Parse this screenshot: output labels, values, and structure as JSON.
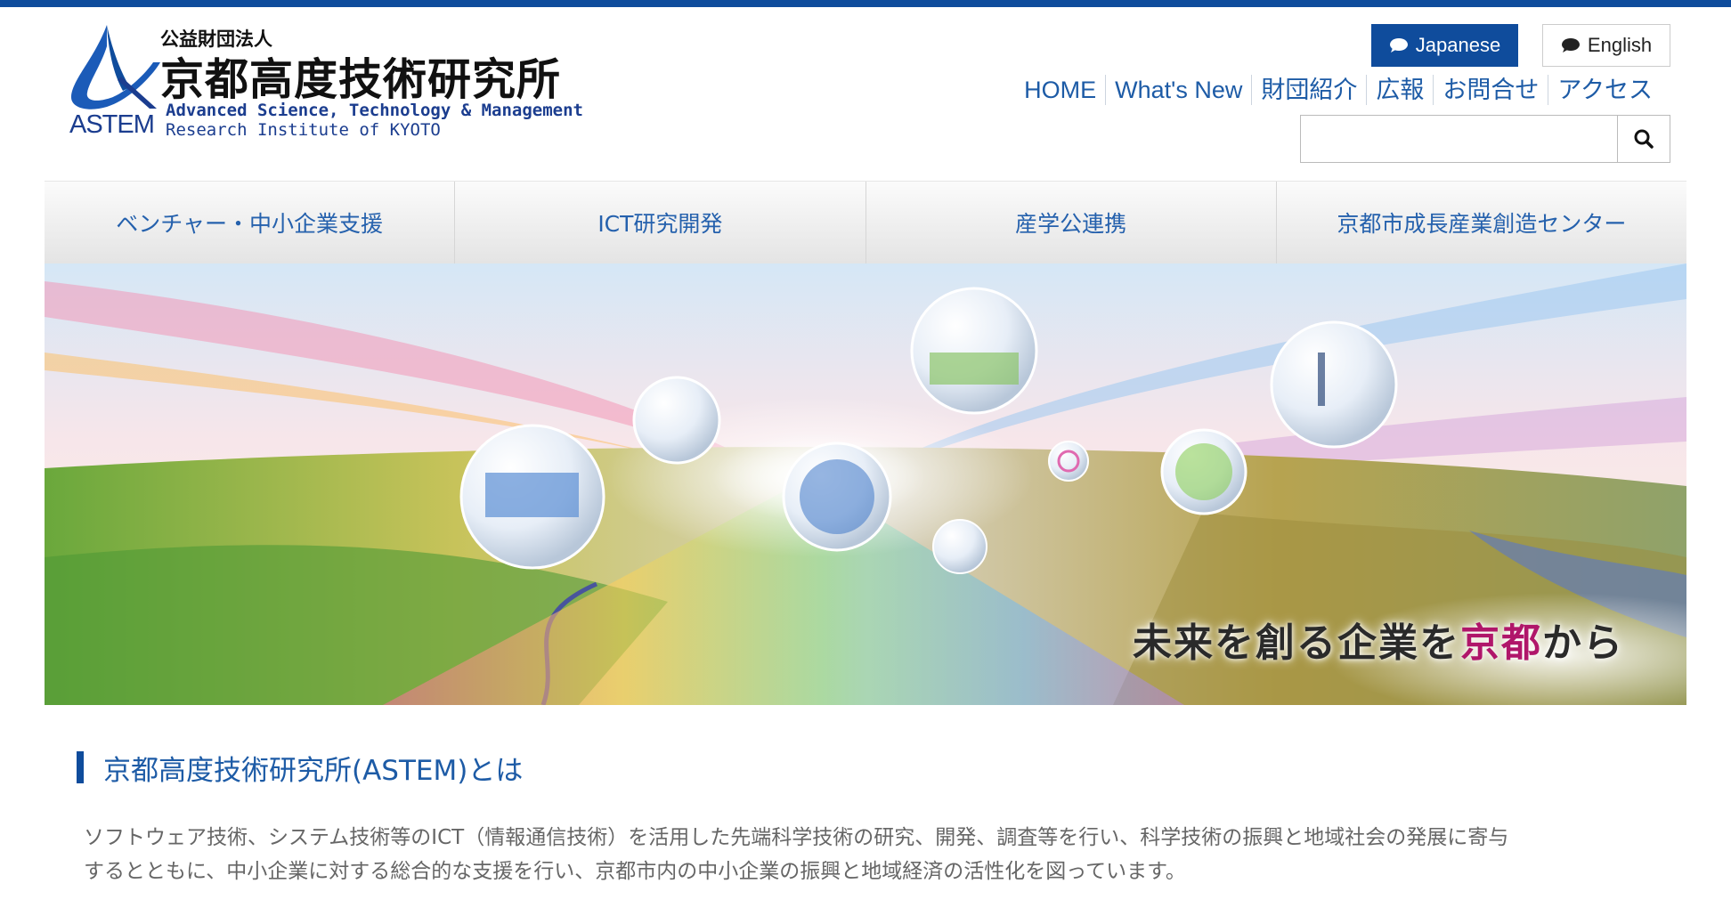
{
  "logo": {
    "small_text": "公益財団法人",
    "title": "京都高度技術研究所",
    "abbr": "ASTEM",
    "english_line1": "Advanced Science, Technology & Management",
    "english_line2": "Research Institute of KYOTO"
  },
  "language": {
    "japanese_label": "Japanese",
    "english_label": "English"
  },
  "header_nav": [
    {
      "label": "HOME"
    },
    {
      "label": "What's New"
    },
    {
      "label": "財団紹介"
    },
    {
      "label": "広報"
    },
    {
      "label": "お問合せ"
    },
    {
      "label": "アクセス"
    }
  ],
  "search": {
    "placeholder": "",
    "icon": "search-icon"
  },
  "main_nav": [
    {
      "label": "ベンチャー・中小企業支援"
    },
    {
      "label": "ICT研究開発"
    },
    {
      "label": "産学公連携"
    },
    {
      "label": "京都市成長産業創造センター"
    }
  ],
  "hero": {
    "tagline_pre": "未来を創る企業を",
    "tagline_accent": "京都",
    "tagline_post": "から"
  },
  "about": {
    "title": "京都高度技術研究所(ASTEM)とは",
    "body_line1": "ソフトウェア技術、システム技術等のICT（情報通信技術）を活用した先端科学技術の研究、開発、調査等を行い、科学技術の振興と地域社会の発展に寄与",
    "body_line2": "するとともに、中小企業に対する総合的な支援を行い、京都市内の中小企業の振興と地域経済の活性化を図っています。"
  },
  "colors": {
    "brand_blue": "#0f4c9c",
    "link_blue": "#1d5ba6",
    "accent_magenta": "#b0166a"
  }
}
